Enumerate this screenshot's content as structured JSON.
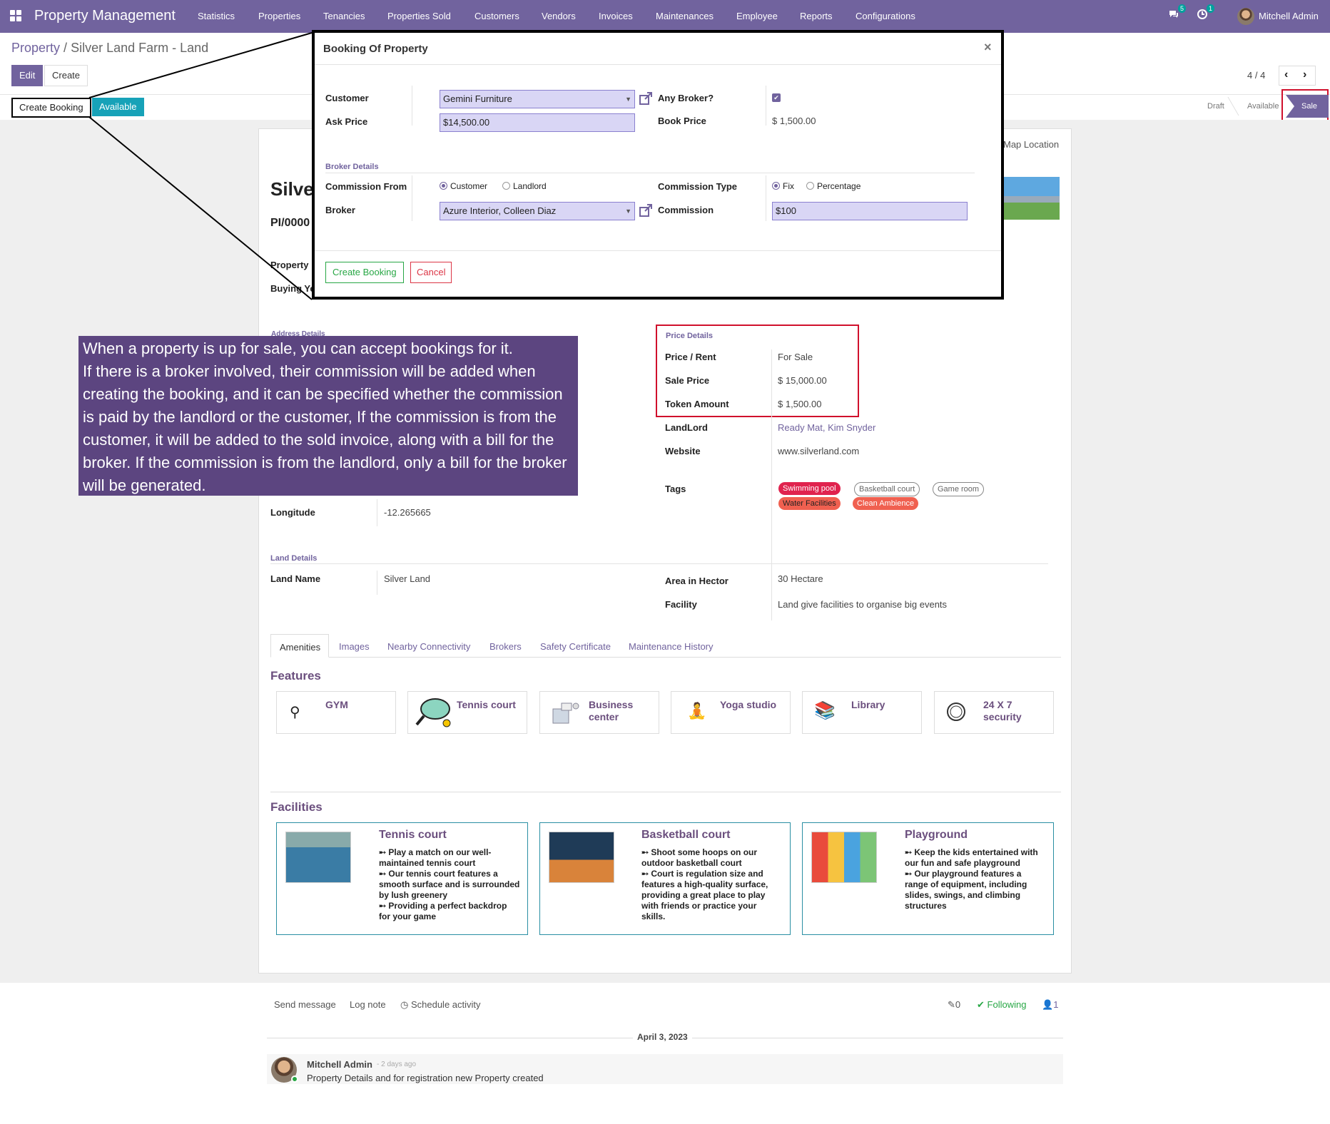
{
  "nav": {
    "brand": "Property Management",
    "menus": [
      "Statistics",
      "Properties",
      "Tenancies",
      "Properties Sold",
      "Customers",
      "Vendors",
      "Invoices",
      "Maintenances",
      "Employee",
      "Reports",
      "Configurations"
    ],
    "messages_badge": "5",
    "activity_badge": "1",
    "user": "Mitchell Admin",
    "icons": [
      "apps-grid-icon",
      "chat-icon",
      "clock-icon"
    ]
  },
  "breadcrumb": {
    "parent": "Property",
    "sep": "/",
    "current": "Silver Land Farm - Land"
  },
  "control": {
    "edit": "Edit",
    "create": "Create",
    "pager": "4 / 4"
  },
  "statusbar": {
    "create_booking": "Create Booking",
    "available_badge": "Available",
    "stages": [
      "Draft",
      "Available",
      "Sale"
    ],
    "active_stage": "Sale"
  },
  "sheet": {
    "map_location": "Map Location",
    "title_partial": "Silve",
    "ref_partial": "PI/0000",
    "property_label_partial": "Property",
    "buying_label_partial": "Buying Ye",
    "address_partial": "Address Details",
    "longitude_label": "Longitude",
    "longitude_value": "-12.265665",
    "price": {
      "section": "Price Details",
      "price_rent_label": "Price / Rent",
      "price_rent_value": "For Sale",
      "sale_price_label": "Sale Price",
      "sale_price_value": "$ 15,000.00",
      "token_label": "Token Amount",
      "token_value": "$ 1,500.00"
    },
    "landlord_label": "LandLord",
    "landlord_value": "Ready Mat, Kim Snyder",
    "website_label": "Website",
    "website_value": "www.silverland.com",
    "tags_label": "Tags",
    "tags": [
      "Swimming pool",
      "Basketball court",
      "Game room",
      "Water Facilities",
      "Clean Ambience"
    ],
    "land": {
      "section": "Land Details",
      "name_label": "Land Name",
      "name_value": "Silver Land",
      "area_label": "Area in Hector",
      "area_value": "30 Hectare",
      "facility_label": "Facility",
      "facility_value": "Land give facilities to organise big events"
    },
    "tabs": [
      "Amenities",
      "Images",
      "Nearby Connectivity",
      "Brokers",
      "Safety Certificate",
      "Maintenance History"
    ],
    "features_title": "Features",
    "features": [
      "GYM",
      "Tennis court",
      "Business center",
      "Yoga studio",
      "Library",
      "24 X 7 security"
    ],
    "facilities_title": "Facilities",
    "facilities": [
      {
        "title": "Tennis court",
        "lines": [
          "➸ Play a match on our well-maintained tennis court",
          "➸ Our tennis court features a smooth surface and is surrounded by lush greenery",
          "➸ Providing a perfect backdrop for your game"
        ]
      },
      {
        "title": "Basketball court",
        "lines": [
          "➸ Shoot some hoops on our outdoor basketball court",
          "➸ Court is regulation size and features a high-quality surface, providing a great place to play with friends or practice your skills."
        ]
      },
      {
        "title": "Playground",
        "lines": [
          "➸ Keep the kids entertained with our fun and safe playground",
          "➸ Our playground features a range of equipment, including slides, swings, and climbing structures"
        ]
      }
    ]
  },
  "chatter": {
    "send_message": "Send message",
    "log_note": "Log note",
    "schedule": "Schedule activity",
    "attachments": "0",
    "following": "Following",
    "followers": "1",
    "date": "April 3, 2023",
    "author": "Mitchell Admin",
    "ago": "- 2 days ago",
    "message": "Property Details and for registration new Property created"
  },
  "dialog": {
    "title": "Booking Of Property",
    "close": "×",
    "customer_label": "Customer",
    "customer_value": "Gemini Furniture",
    "ask_price_label": "Ask Price",
    "ask_price_value": "$14,500.00",
    "any_broker_label": "Any Broker?",
    "book_price_label": "Book Price",
    "book_price_value": "$ 1,500.00",
    "broker_section": "Broker Details",
    "commission_from_label": "Commission From",
    "commission_from_options": [
      "Customer",
      "Landlord"
    ],
    "commission_from_selected": "Customer",
    "broker_label": "Broker",
    "broker_value": "Azure Interior, Colleen Diaz",
    "commission_type_label": "Commission Type",
    "commission_type_options": [
      "Fix",
      "Percentage"
    ],
    "commission_type_selected": "Fix",
    "commission_label": "Commission",
    "commission_value": "$100",
    "create_button": "Create Booking",
    "cancel_button": "Cancel"
  },
  "callout": {
    "lines": [
      "When a property is up for sale, you can accept bookings for it.",
      "If there is a broker involved, their commission will be added when creating the booking, and it can be specified whether the commission is paid by the landlord or the customer, If the commission is from the customer, it will be added to the sold invoice, along with a bill for the broker. If the commission is from the landlord, only a bill for the broker will be generated."
    ]
  },
  "colors": {
    "brand": "#71639e",
    "teal": "#17a2b8",
    "highlight_box": "#d0102c",
    "tag_red": "#e0234e",
    "tag_orange": "#f06050"
  }
}
